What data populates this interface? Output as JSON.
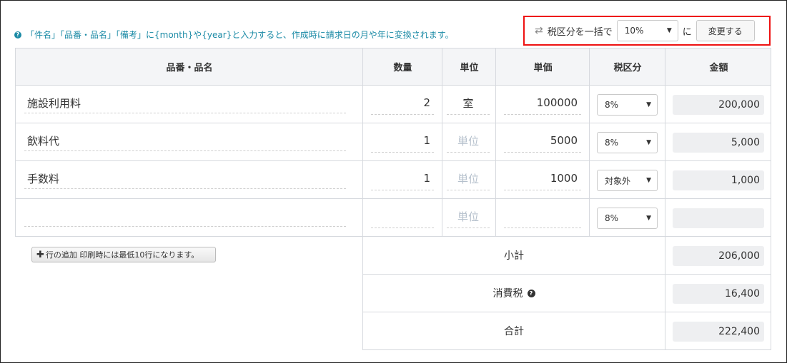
{
  "info_text": "「件名」「品番・品名」「備考」に{month}や{year}と入力すると、作成時に請求日の月や年に変換されます。",
  "bulk": {
    "label": "税区分を一括で",
    "selected": "10%",
    "suffix": "に",
    "button": "変更する"
  },
  "table": {
    "headers": {
      "name": "品番・品名",
      "qty": "数量",
      "unit": "単位",
      "price": "単価",
      "tax": "税区分",
      "amount": "金額"
    },
    "unit_placeholder": "単位",
    "rows": [
      {
        "name": "施設利用料",
        "qty": "2",
        "unit": "室",
        "price": "100000",
        "tax": "8%",
        "amount": "200,000"
      },
      {
        "name": "飲料代",
        "qty": "1",
        "unit": "",
        "price": "5000",
        "tax": "8%",
        "amount": "5,000"
      },
      {
        "name": "手数料",
        "qty": "1",
        "unit": "",
        "price": "1000",
        "tax": "対象外",
        "amount": "1,000"
      },
      {
        "name": "",
        "qty": "",
        "unit": "",
        "price": "",
        "tax": "8%",
        "amount": ""
      }
    ]
  },
  "add_row_button": "行の追加 印刷時には最低10行になります。",
  "summary": {
    "subtotal_label": "小計",
    "subtotal": "206,000",
    "tax_label": "消費税",
    "tax": "16,400",
    "total_label": "合計",
    "total": "222,400"
  }
}
